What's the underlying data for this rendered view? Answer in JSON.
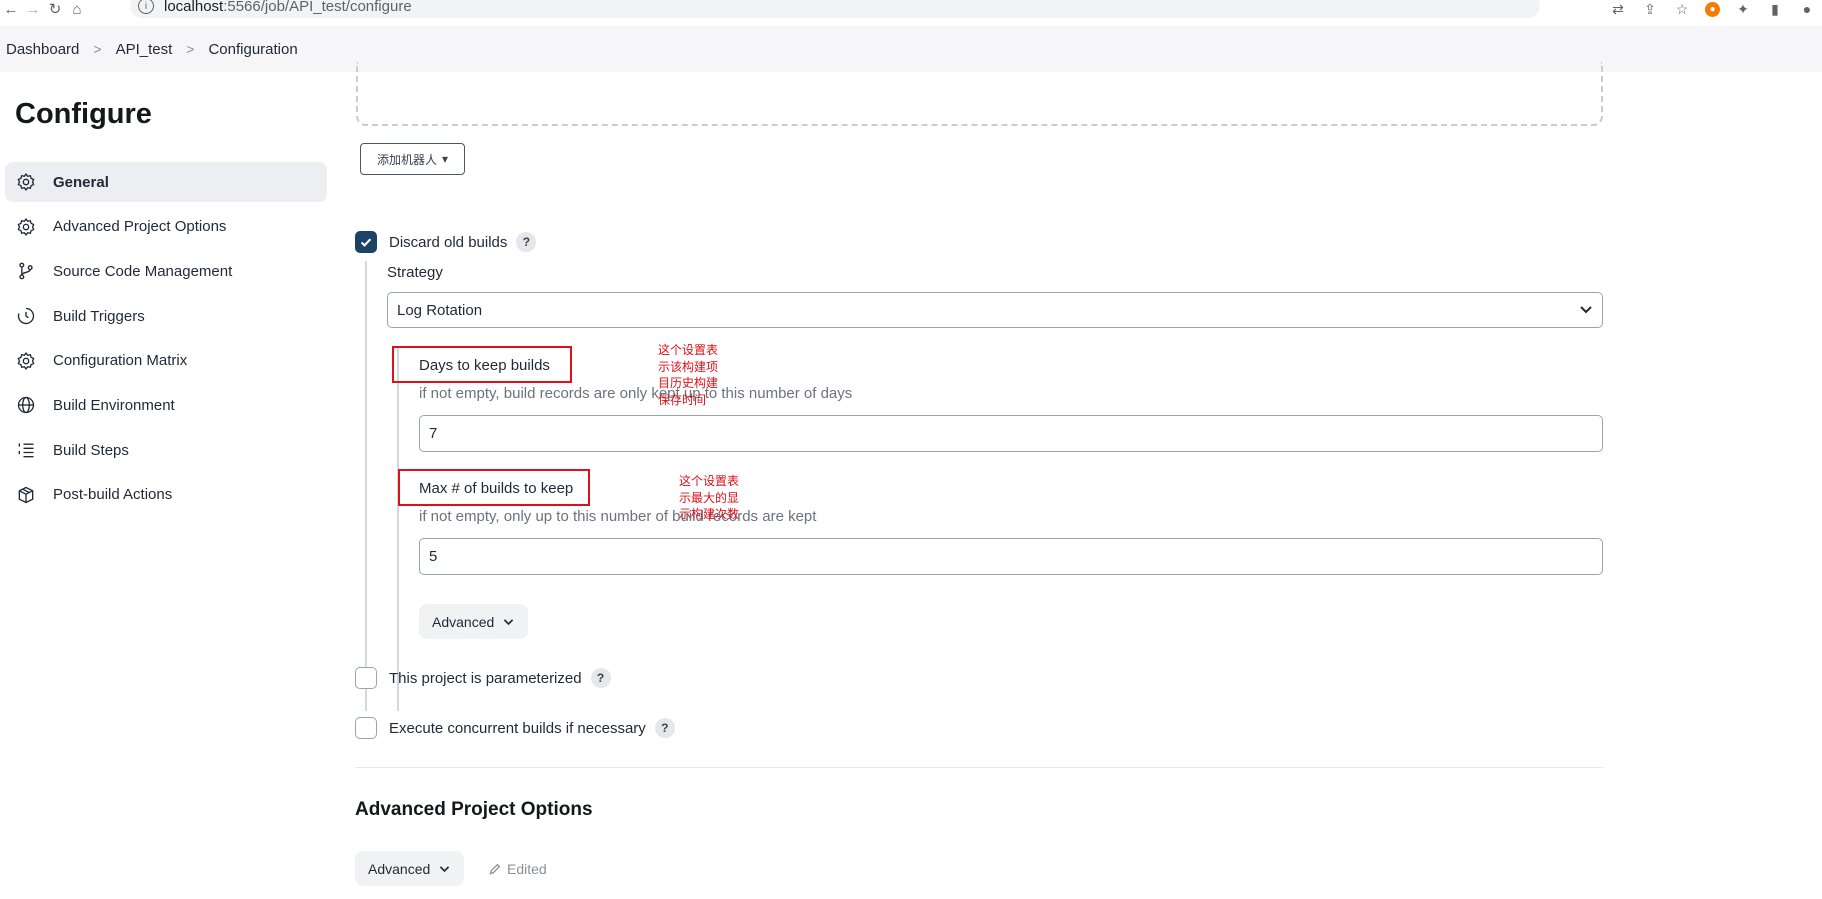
{
  "browser": {
    "url_host": "localhost",
    "url_path": ":5566/job/API_test/configure"
  },
  "breadcrumb": [
    "Dashboard",
    "API_test",
    "Configuration"
  ],
  "sidebar": {
    "title": "Configure",
    "items": [
      {
        "label": "General",
        "icon": "gear-icon",
        "active": true
      },
      {
        "label": "Advanced Project Options",
        "icon": "gear-icon"
      },
      {
        "label": "Source Code Management",
        "icon": "branch-icon"
      },
      {
        "label": "Build Triggers",
        "icon": "clock-icon"
      },
      {
        "label": "Configuration Matrix",
        "icon": "gear-icon"
      },
      {
        "label": "Build Environment",
        "icon": "globe-icon"
      },
      {
        "label": "Build Steps",
        "icon": "list-icon"
      },
      {
        "label": "Post-build Actions",
        "icon": "package-icon"
      }
    ]
  },
  "main": {
    "add_robot_label": "添加机器人",
    "discard_old_builds": {
      "label": "Discard old builds",
      "checked": true
    },
    "strategy_label": "Strategy",
    "strategy_value": "Log Rotation",
    "days_field": {
      "label": "Days to keep builds",
      "help": "if not empty, build records are only kept up to this number of days",
      "value": "7"
    },
    "max_field": {
      "label": "Max # of builds to keep",
      "help": "if not empty, only up to this number of build records are kept",
      "value": "5"
    },
    "advanced_label": "Advanced",
    "parameterized": {
      "label": "This project is parameterized",
      "checked": false
    },
    "concurrent": {
      "label": "Execute concurrent builds if necessary",
      "checked": false
    },
    "section_title": "Advanced Project Options",
    "section_advanced_label": "Advanced",
    "edited_label": "Edited",
    "help_glyph": "?"
  },
  "annotations": {
    "days_note": "这个设置表示该构建项目历史构建保存时间",
    "max_note": "这个设置表示最大的显示构建次数"
  },
  "colors": {
    "highlight": "#e0101a",
    "checkbox_checked": "#1c4366"
  }
}
